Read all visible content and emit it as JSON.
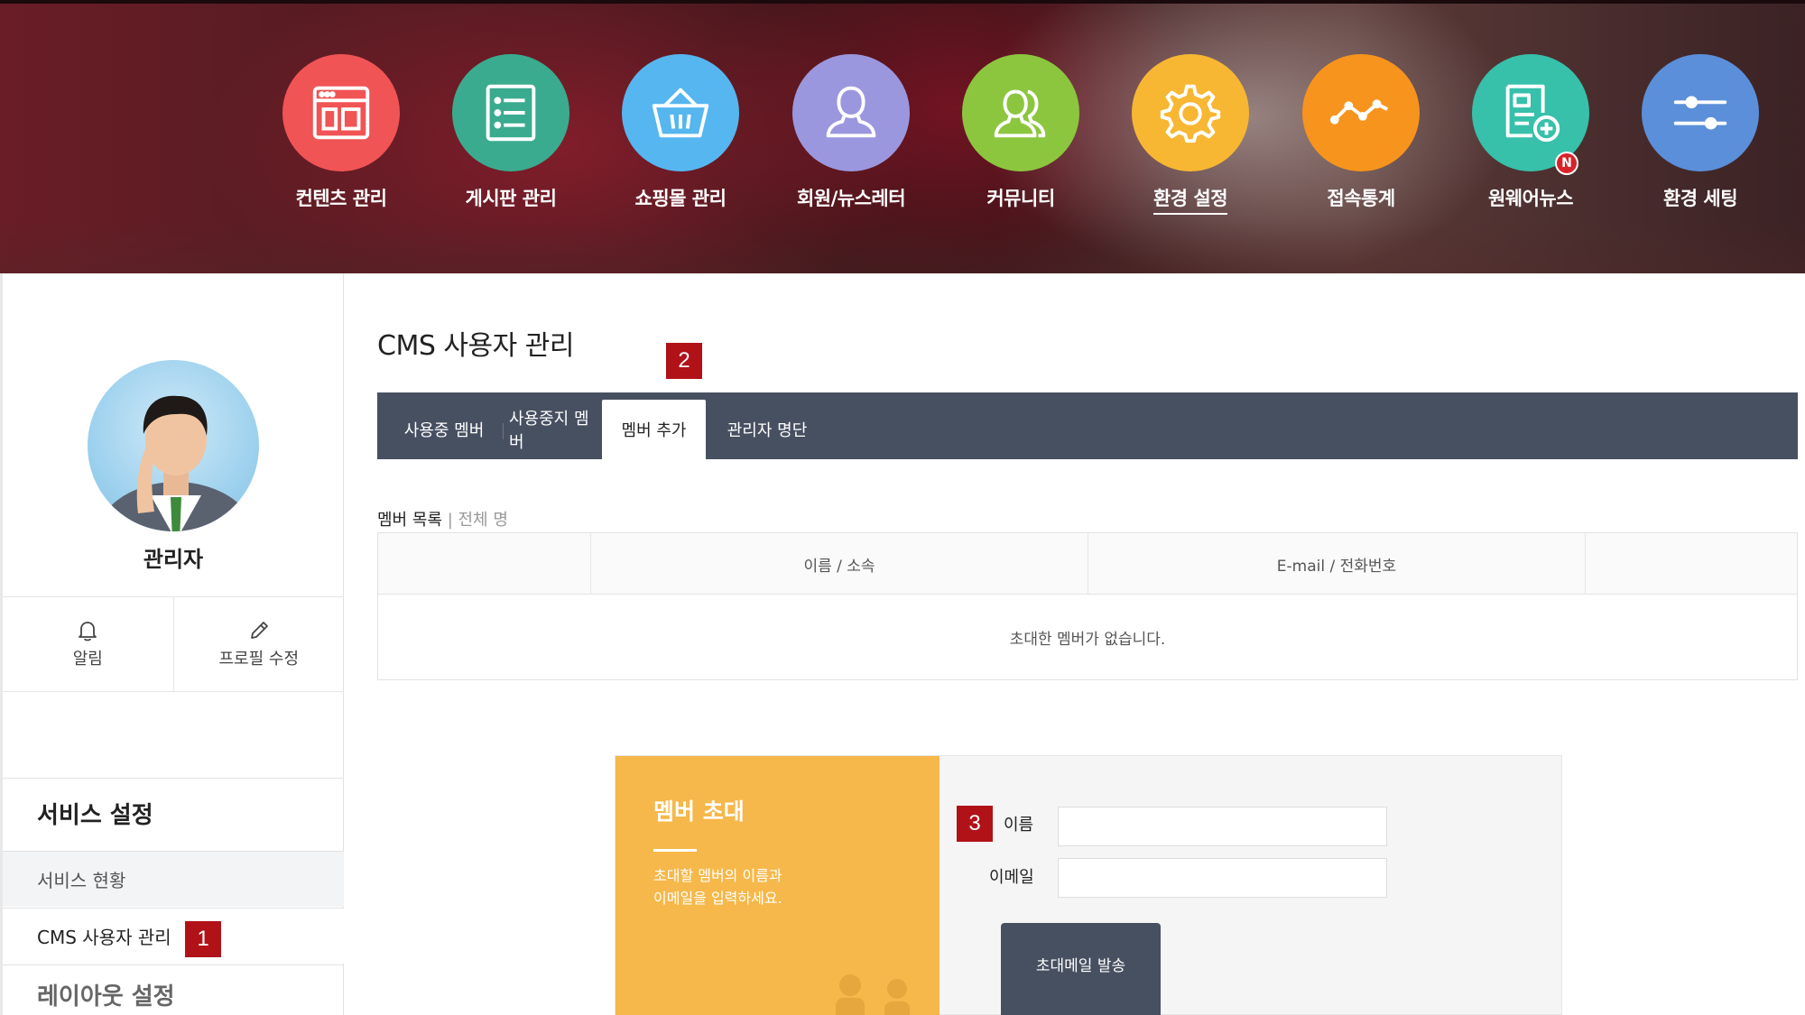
{
  "top_menu": [
    {
      "label": "컨텐츠 관리",
      "icon": "layout-icon",
      "color": "#f05455"
    },
    {
      "label": "게시판 관리",
      "icon": "list-icon",
      "color": "#3aab8f"
    },
    {
      "label": "쇼핑몰 관리",
      "icon": "basket-icon",
      "color": "#56b6ef"
    },
    {
      "label": "회원/뉴스레터",
      "icon": "user-icon",
      "color": "#9b97de"
    },
    {
      "label": "커뮤니티",
      "icon": "users-icon",
      "color": "#8cc63f"
    },
    {
      "label": "환경 설정",
      "icon": "gear-icon",
      "color": "#f7b733",
      "active": true
    },
    {
      "label": "접속통계",
      "icon": "trend-icon",
      "color": "#f7941d"
    },
    {
      "label": "원웨어뉴스",
      "icon": "news-add-icon",
      "color": "#37c0aa",
      "badge": "N"
    },
    {
      "label": "환경 세팅",
      "icon": "sliders-icon",
      "color": "#5b8fd9"
    }
  ],
  "sidebar": {
    "profile_name": "관리자",
    "actions": [
      {
        "label": "알림",
        "icon": "bell-icon"
      },
      {
        "label": "프로필 수정",
        "icon": "pencil-icon"
      }
    ],
    "service_heading": "서비스 설정",
    "items": [
      {
        "label": "서비스 현황"
      },
      {
        "label": "CMS 사용자 관리",
        "marker": "1"
      }
    ],
    "layout_heading": "레이아웃 설정"
  },
  "main": {
    "page_title": "CMS 사용자 관리",
    "marker": "2",
    "tabs": [
      {
        "label": "사용중 멤버"
      },
      {
        "label": "사용중지 멤버"
      },
      {
        "label": "멤버 추가",
        "active": true
      },
      {
        "label": "관리자 명단"
      }
    ],
    "list_caption": "멤버 목록",
    "list_caption_sub": "| 전체 명",
    "table": {
      "columns": [
        "",
        "이름 / 소속",
        "E-mail / 전화번호",
        ""
      ],
      "empty_message": "초대한 멤버가 없습니다."
    }
  },
  "invite": {
    "title": "멤버 초대",
    "desc_line1": "초대할 멤버의 이름과",
    "desc_line2": "이메일을 입력하세요.",
    "marker": "3",
    "name_label": "이름",
    "name_value": "",
    "email_label": "이메일",
    "email_value": "",
    "send_label": "초대메일 발송",
    "accent_color": "#f6b84a",
    "button_color": "#475061"
  },
  "colors": {
    "tabbar_bg": "#475061",
    "marker_red": "#b01218",
    "badge_red": "#d8232a"
  }
}
